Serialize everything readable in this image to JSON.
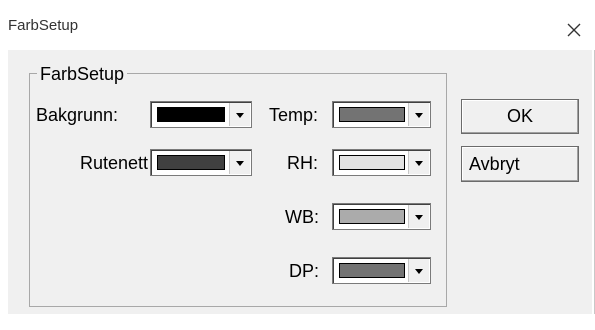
{
  "window": {
    "title": "FarbSetup"
  },
  "group": {
    "legend": "FarbSetup"
  },
  "fields": [
    {
      "id": "bakgrunn",
      "label": "Bakgrunn:",
      "color": "#000000"
    },
    {
      "id": "rutenett",
      "label": "Rutenett",
      "color": "#404040"
    },
    {
      "id": "temp",
      "label": "Temp:",
      "color": "#737373"
    },
    {
      "id": "rh",
      "label": "RH:",
      "color": "#e3e3e3"
    },
    {
      "id": "wb",
      "label": "WB:",
      "color": "#ababab"
    },
    {
      "id": "dp",
      "label": "DP:",
      "color": "#737373"
    }
  ],
  "buttons": {
    "ok": "OK",
    "cancel": "Avbryt"
  },
  "icons": {
    "close": "close-icon",
    "dropdown": "chevron-down-icon"
  }
}
